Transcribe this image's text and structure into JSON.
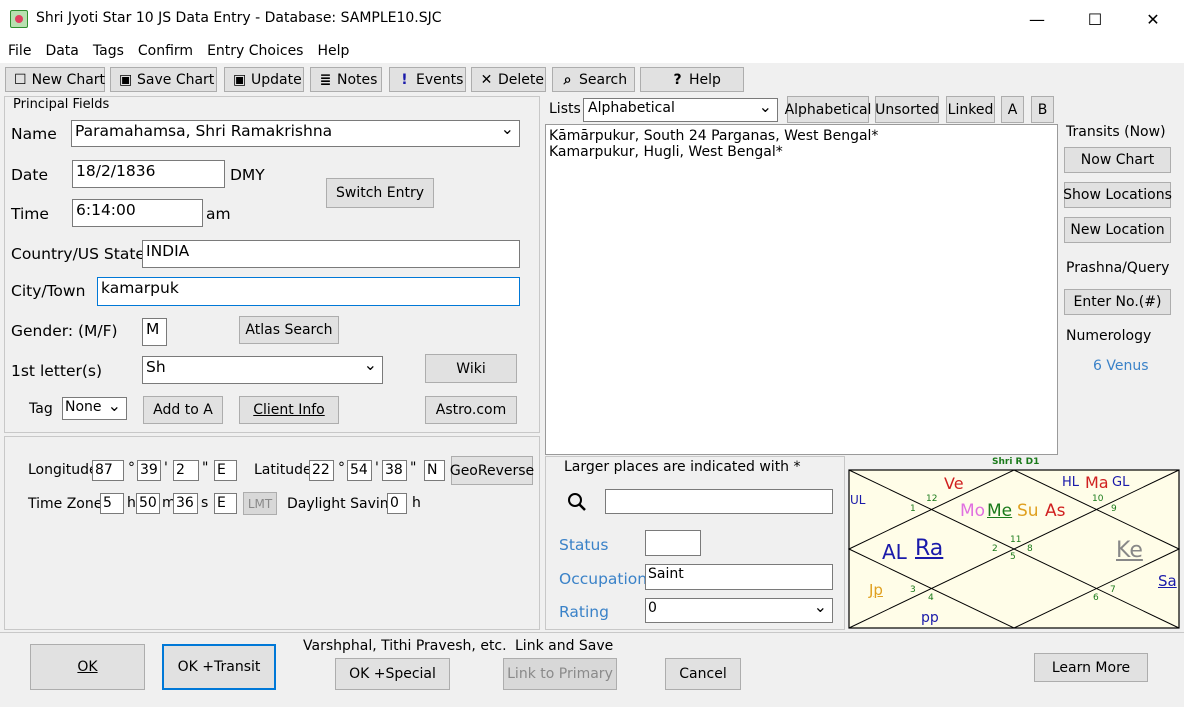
{
  "title": "Shri Jyoti Star 10 JS   Data Entry - Database: SAMPLE10.SJC",
  "window_controls": {
    "minimize": "—",
    "maximize": "☐",
    "close": "✕"
  },
  "menu": [
    "File",
    "Data",
    "Tags",
    "Confirm",
    "Entry Choices",
    "Help"
  ],
  "toolbar": [
    {
      "label": "New Chart",
      "icon": "☐"
    },
    {
      "label": "Save Chart",
      "icon": "▣"
    },
    {
      "label": "Update",
      "icon": "▣"
    },
    {
      "label": "Notes",
      "icon": "≣"
    },
    {
      "label": "Events",
      "icon": "!"
    },
    {
      "label": "Delete",
      "icon": "✕"
    },
    {
      "label": "Search",
      "icon": "⌕"
    },
    {
      "label": "Help",
      "icon": "?"
    }
  ],
  "principal": {
    "heading": "Principal Fields",
    "name_label": "Name",
    "name_value": "Paramahamsa, Shri Ramakrishna",
    "date_label": "Date",
    "date_value": "18/2/1836",
    "date_fmt": "DMY",
    "time_label": "Time",
    "time_value": "6:14:00",
    "time_ampm": "am",
    "switch_entry": "Switch Entry",
    "country_label": "Country/US State",
    "country_value": "INDIA",
    "city_label": "City/Town",
    "city_value": "kamarpuk",
    "gender_label": "Gender: (M/F)",
    "gender_value": "M",
    "atlas_search": "Atlas Search",
    "first_letter_label": "1st letter(s)",
    "first_letter_value": "Sh",
    "wiki": "Wiki",
    "tag_label": "Tag",
    "tag_value": "None",
    "add_to_a": "Add to A",
    "client_info": "Client Info",
    "astro_com": "Astro.com"
  },
  "coords": {
    "longitude_label": "Longitude",
    "lon_deg": "87",
    "lon_min": "39",
    "lon_sec": "2",
    "lon_dir": "E",
    "latitude_label": "Latitude",
    "lat_deg": "22",
    "lat_min": "54",
    "lat_sec": "38",
    "lat_dir": "N",
    "georeverse": "GeoReverse",
    "tz_label": "Time Zone",
    "tz_h": "5",
    "tz_m": "50",
    "tz_s": "36",
    "tz_dir": "E",
    "lmt": "LMT",
    "dst_label": "Daylight Saving",
    "dst_value": "0",
    "dst_unit": "h",
    "deg": "°",
    "min": "'",
    "sec": "\"",
    "h": "h",
    "m": "m",
    "s": "s"
  },
  "lists": {
    "label": "Lists",
    "select_value": "Alphabetical",
    "buttons": [
      "Alphabetical",
      "Unsorted",
      "Linked",
      "A",
      "B"
    ],
    "items": [
      "Kāmārpukur, South 24 Parganas, West Bengal*",
      "Kamarpukur, Hugli, West Bengal*"
    ]
  },
  "right": {
    "transits": "Transits (Now)",
    "now_chart": "Now Chart",
    "show_locations": "Show Locations",
    "new_location": "New Location",
    "prashna": "Prashna/Query",
    "enter_no": "Enter No.(#)",
    "numerology": "Numerology",
    "numerology_value": "6 Venus"
  },
  "details": {
    "note": "Larger places are indicated with *",
    "search_value": "",
    "status_label": "Status",
    "status_value": "",
    "occupation_label": "Occupation",
    "occupation_value": "Saint",
    "rating_label": "Rating",
    "rating_value": "0"
  },
  "chart": {
    "title": "Shri R D1",
    "planets": {
      "Ve": "Ve",
      "HL": "HL",
      "Ma": "Ma",
      "GL": "GL",
      "UL": "UL",
      "Mo": "Mo",
      "Me": "Me",
      "Su": "Su",
      "As": "As",
      "AL": "AL",
      "Ra": "Ra",
      "Ke": "Ke",
      "Sa": "Sa",
      "Jp": "Jp",
      "pp": "pp"
    },
    "houses": [
      "12",
      "1",
      "10",
      "9",
      "11",
      "2",
      "5",
      "8",
      "3",
      "4",
      "6",
      "7"
    ],
    "colors": {
      "Ve": "#d02020",
      "Ma": "#d02020",
      "As": "#d02020",
      "Mo": "#e070e0",
      "Me": "#1a7a1a",
      "Su": "#e0a020",
      "AL": "#1a1aaa",
      "Ra": "#1a1aaa",
      "Ke": "#888888",
      "Sa": "#1a1aaa",
      "Jp": "#e0a020",
      "HL": "#1a1aaa",
      "GL": "#1a1aaa",
      "UL": "#1a1aaa",
      "pp": "#1a1aaa"
    }
  },
  "bottom": {
    "ok": "OK",
    "ok_transit": "OK +Transit",
    "varshphal": "Varshphal, Tithi Pravesh, etc.",
    "ok_special": "OK +Special",
    "link_save": "Link and Save",
    "link_primary": "Link to Primary",
    "cancel": "Cancel",
    "learn_more": "Learn More"
  }
}
